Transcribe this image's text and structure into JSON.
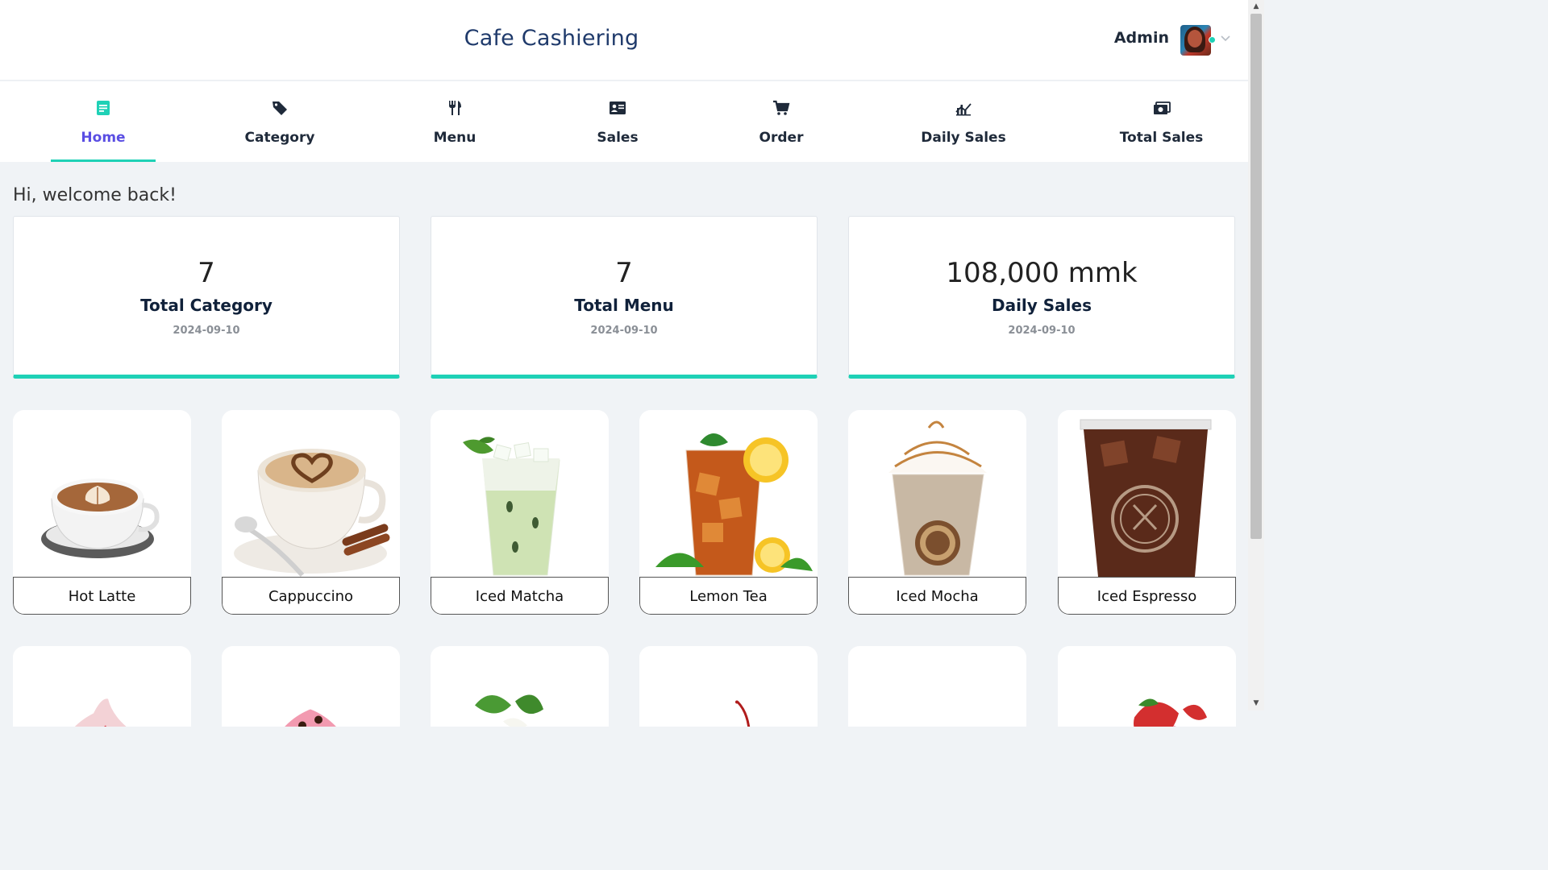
{
  "header": {
    "title": "Cafe Cashiering",
    "user_name": "Admin"
  },
  "nav": [
    {
      "label": "Home",
      "icon": "document-icon",
      "active": true
    },
    {
      "label": "Category",
      "icon": "tag-icon"
    },
    {
      "label": "Menu",
      "icon": "utensils-icon"
    },
    {
      "label": "Sales",
      "icon": "id-card-icon"
    },
    {
      "label": "Order",
      "icon": "cart-icon"
    },
    {
      "label": "Daily Sales",
      "icon": "chart-icon"
    },
    {
      "label": "Total Sales",
      "icon": "money-icon"
    }
  ],
  "welcome": "Hi, welcome back!",
  "stats": [
    {
      "value": "7",
      "label": "Total Category",
      "date": "2024-09-10"
    },
    {
      "value": "7",
      "label": "Total Menu",
      "date": "2024-09-10"
    },
    {
      "value": "108,000 mmk",
      "label": "Daily Sales",
      "date": "2024-09-10"
    }
  ],
  "menu_items": [
    {
      "name": "Hot Latte"
    },
    {
      "name": "Cappuccino"
    },
    {
      "name": "Iced Matcha"
    },
    {
      "name": "Lemon Tea"
    },
    {
      "name": "Iced Mocha"
    },
    {
      "name": "Iced Espresso"
    }
  ],
  "colors": {
    "accent": "#1fd1b6",
    "active_nav": "#5a4ee3",
    "title": "#1f3a6b"
  }
}
